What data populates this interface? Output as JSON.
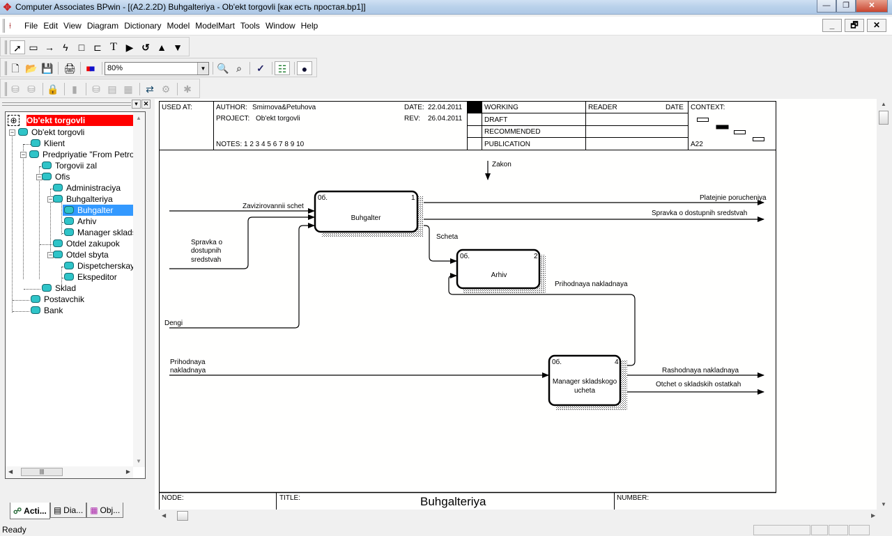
{
  "window": {
    "title": "Computer Associates BPwin - [(A2.2.2D) Buhgalteriya - Ob'ekt torgovli  [как есть простая.bp1]]",
    "minimize": "—",
    "restore": "❐",
    "close": "✕"
  },
  "menu": {
    "items": [
      "File",
      "Edit",
      "View",
      "Diagram",
      "Dictionary",
      "Model",
      "ModelMart",
      "Tools",
      "Window",
      "Help"
    ],
    "mdi_minimize": "_",
    "mdi_restore": "🗗",
    "mdi_close": "✕"
  },
  "toolbar1": {
    "tools": [
      {
        "name": "pointer-tool-icon",
        "glyph": "➚"
      },
      {
        "name": "activity-box-tool-icon",
        "glyph": "▭"
      },
      {
        "name": "arrow-tool-icon",
        "glyph": "→"
      },
      {
        "name": "squiggle-tool-icon",
        "glyph": "ϟ"
      },
      {
        "name": "rectangle-tool-icon",
        "glyph": "□"
      },
      {
        "name": "external-reference-tool-icon",
        "glyph": "⊏"
      },
      {
        "name": "text-tool-icon",
        "glyph": "T"
      },
      {
        "name": "go-to-child-icon",
        "glyph": "▶"
      },
      {
        "name": "rotate-icon",
        "glyph": "↺"
      },
      {
        "name": "go-to-parent-icon",
        "glyph": "▲"
      },
      {
        "name": "go-to-sibling-icon",
        "glyph": "▼"
      }
    ]
  },
  "toolbar2": {
    "zoom_value": "80%",
    "new": "🗋",
    "open": "📂",
    "save": "💾",
    "print": "🖨",
    "color": "■",
    "zoom_in": "🔍",
    "zoom_fit": "⌕",
    "spell": "✓",
    "model_explorer": "☷",
    "modelmart": "●"
  },
  "toolbar3": {
    "buttons": [
      "⛁",
      "⛁",
      "🔒",
      "▮",
      "⛁",
      "▤",
      "▦",
      "⇄",
      "⚙",
      "✱"
    ]
  },
  "explorer": {
    "root_label": "Ob'ekt torgovli",
    "items": [
      {
        "label": "Ob'ekt torgovli",
        "level": 0,
        "expanded": true
      },
      {
        "label": "Klient",
        "level": 1
      },
      {
        "label": "Predpriyatie  \"From Petrov",
        "level": 1,
        "expanded": true
      },
      {
        "label": "Torgovii zal",
        "level": 2
      },
      {
        "label": "Ofis",
        "level": 2,
        "expanded": true
      },
      {
        "label": "Administraciya",
        "level": 3
      },
      {
        "label": "Buhgalteriya",
        "level": 3,
        "expanded": true
      },
      {
        "label": "Buhgalter",
        "level": 4,
        "selected": true
      },
      {
        "label": "Arhiv",
        "level": 4
      },
      {
        "label": "Manager sklads",
        "level": 4
      },
      {
        "label": "Otdel zakupok",
        "level": 3
      },
      {
        "label": "Otdel sbyta",
        "level": 3,
        "expanded": true
      },
      {
        "label": "Dispetcherskay",
        "level": 4
      },
      {
        "label": "Ekspeditor",
        "level": 4
      },
      {
        "label": "Sklad",
        "level": 2
      },
      {
        "label": "Postavchik",
        "level": 1
      },
      {
        "label": "Bank",
        "level": 1
      }
    ],
    "tabs": [
      "Acti...",
      "Dia...",
      "Obj..."
    ]
  },
  "frame": {
    "used_at": "USED AT:",
    "author_label": "AUTHOR:",
    "author": "Smirnova&Petuhova",
    "project_label": "PROJECT:",
    "project": "Ob'ekt torgovli",
    "date_label": "DATE:",
    "date": "22.04.2011",
    "rev_label": "REV:",
    "rev": "26.04.2011",
    "notes": "NOTES:  1  2  3  4  5  6  7  8  9  10",
    "status": [
      "WORKING",
      "DRAFT",
      "RECOMMENDED",
      "PUBLICATION"
    ],
    "reader": "READER",
    "date_col": "DATE",
    "context": "CONTEXT:",
    "context_node": "A22",
    "node_label": "NODE:",
    "title_label": "TITLE:",
    "title": "Buhgalteriya",
    "number_label": "NUMBER:"
  },
  "diagram": {
    "boxes": [
      {
        "id": "buhgalter",
        "label": "Buhgalter",
        "tag": "0б.",
        "num": "1"
      },
      {
        "id": "arhiv",
        "label": "Arhiv",
        "tag": "0б.",
        "num": "2"
      },
      {
        "id": "manager",
        "label": "Manager skladskogo",
        "label2": "ucheta",
        "tag": "0б.",
        "num": "4"
      }
    ],
    "arrows": {
      "zakon": "Zakon",
      "zavizirovannii": "Zavizirovannii schet",
      "spravka_in_1": "Spravka o",
      "spravka_in_2": "dostupnih",
      "spravka_in_3": "sredstvah",
      "dengi": "Dengi",
      "platejnie": "Platejnie porucheniya",
      "spravka_out": "Spravka o dostupnih sredstvah",
      "scheta": "Scheta",
      "prihodnaya_loop": "Prihodnaya nakladnaya",
      "prihodnaya_in_1": "Prihodnaya",
      "prihodnaya_in_2": "nakladnaya",
      "rashodnaya": "Rashodnaya nakladnaya",
      "otchet": "Otchet o skladskih ostatkah"
    }
  },
  "status": {
    "text": "Ready"
  }
}
